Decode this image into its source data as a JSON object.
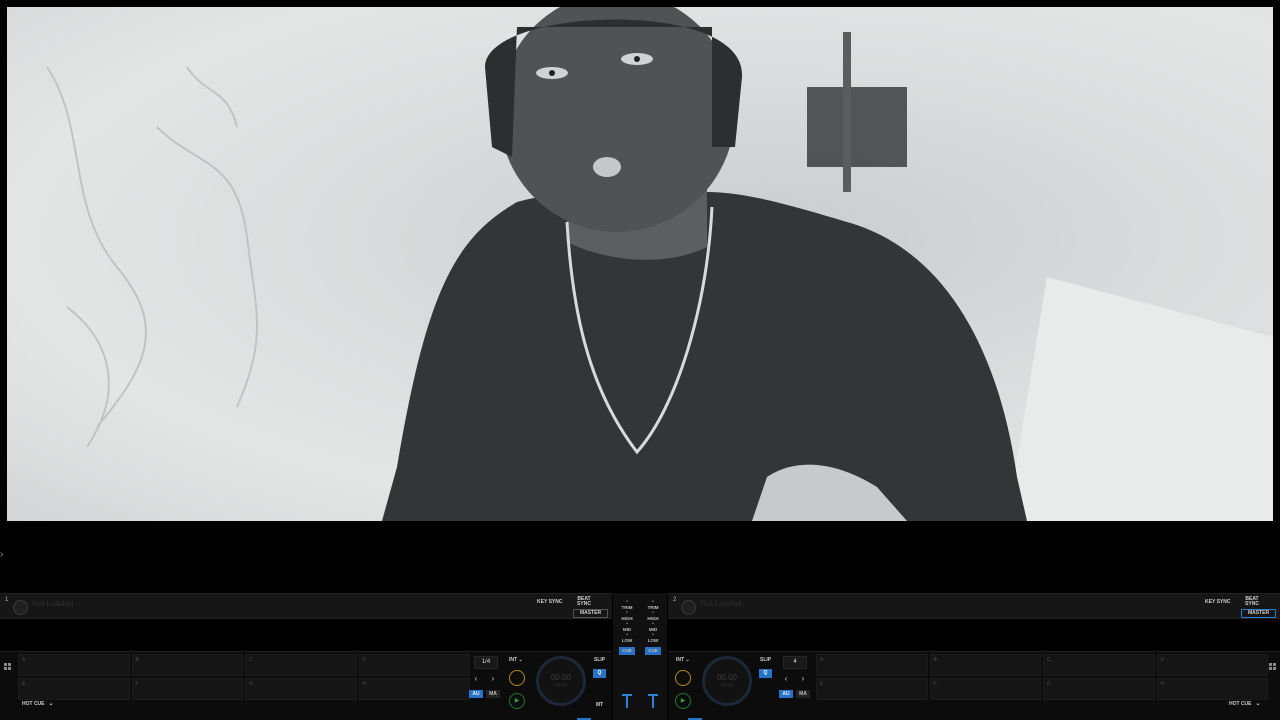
{
  "video": {
    "description_icon": "video-preview",
    "colors": {
      "bg": "#dcdedf",
      "figure": "#2f3131"
    }
  },
  "side_toggle": {
    "icon": "chevron-right-icon",
    "glyph": "›"
  },
  "deck1": {
    "number": "1",
    "title": "Not Loaded",
    "key_sync": "KEY SYNC",
    "beat_sync_1": "BEAT",
    "beat_sync_2": "SYNC",
    "master": "MASTER",
    "pads": [
      "A",
      "B",
      "C",
      "D",
      "E",
      "F",
      "G",
      "H"
    ],
    "hot_cue": "HOT CUE",
    "loop_value": "1/4",
    "int_label": "INT",
    "au_label": "AU",
    "ma_label": "MA",
    "jog_time": "00.00",
    "jog_sub": "00:00",
    "slip": "SLIP",
    "q": "Q",
    "mt": "MT"
  },
  "deck2": {
    "number": "2",
    "title": "Not Loaded",
    "key_sync": "KEY SYNC",
    "beat_sync_1": "BEAT",
    "beat_sync_2": "SYNC",
    "master": "MASTER",
    "pads": [
      "A",
      "B",
      "C",
      "D",
      "E",
      "F",
      "G",
      "H"
    ],
    "hot_cue": "HOT CUE",
    "loop_value": "4",
    "int_label": "INT",
    "au_label": "AU",
    "ma_label": "MA",
    "jog_time": "00.00",
    "jog_sub": "00:00",
    "slip": "SLIP",
    "q": "Q",
    "mt": "MT"
  },
  "mixer": {
    "trim": "TRIM",
    "high": "HIGH",
    "mid": "MID",
    "low": "LOW",
    "cue": "CUE"
  },
  "accent_color": "#2773c7"
}
